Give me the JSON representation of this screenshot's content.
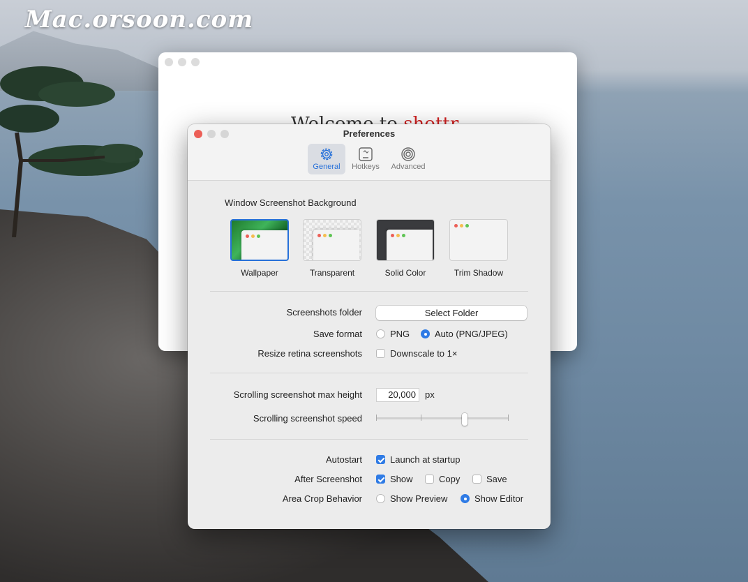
{
  "watermark": "Mac.orsoon.com",
  "welcome_window": {
    "title_prefix": "Welcome to ",
    "title_brand": "shottr"
  },
  "prefs": {
    "title": "Preferences",
    "tabs": [
      {
        "label": "General",
        "icon": "gear-icon",
        "active": true
      },
      {
        "label": "Hotkeys",
        "icon": "keyboard-icon",
        "active": false
      },
      {
        "label": "Advanced",
        "icon": "spiral-icon",
        "active": false
      }
    ],
    "background": {
      "label": "Window Screenshot Background",
      "options": [
        {
          "label": "Wallpaper",
          "selected": true
        },
        {
          "label": "Transparent",
          "selected": false
        },
        {
          "label": "Solid Color",
          "selected": false
        },
        {
          "label": "Trim Shadow",
          "selected": false
        }
      ]
    },
    "folder": {
      "label": "Screenshots folder",
      "button": "Select Folder"
    },
    "format": {
      "label": "Save format",
      "opt1": "PNG",
      "opt2": "Auto (PNG/JPEG)",
      "selected": "Auto (PNG/JPEG)"
    },
    "retina": {
      "label": "Resize retina screenshots",
      "option": "Downscale to 1×",
      "checked": false
    },
    "max_height": {
      "label": "Scrolling screenshot max height",
      "value": "20,000",
      "unit": "px"
    },
    "speed": {
      "label": "Scrolling screenshot speed",
      "level": 0.67
    },
    "autostart": {
      "label": "Autostart",
      "option": "Launch at startup",
      "checked": true
    },
    "after": {
      "label": "After Screenshot",
      "show": "Show",
      "copy": "Copy",
      "save": "Save"
    },
    "crop": {
      "label": "Area Crop Behavior",
      "opt1": "Show Preview",
      "opt2": "Show Editor",
      "selected": "Show Editor"
    }
  },
  "colors": {
    "accent": "#2f7be5",
    "close": "#ec5f57",
    "brand_red": "#d02020"
  }
}
